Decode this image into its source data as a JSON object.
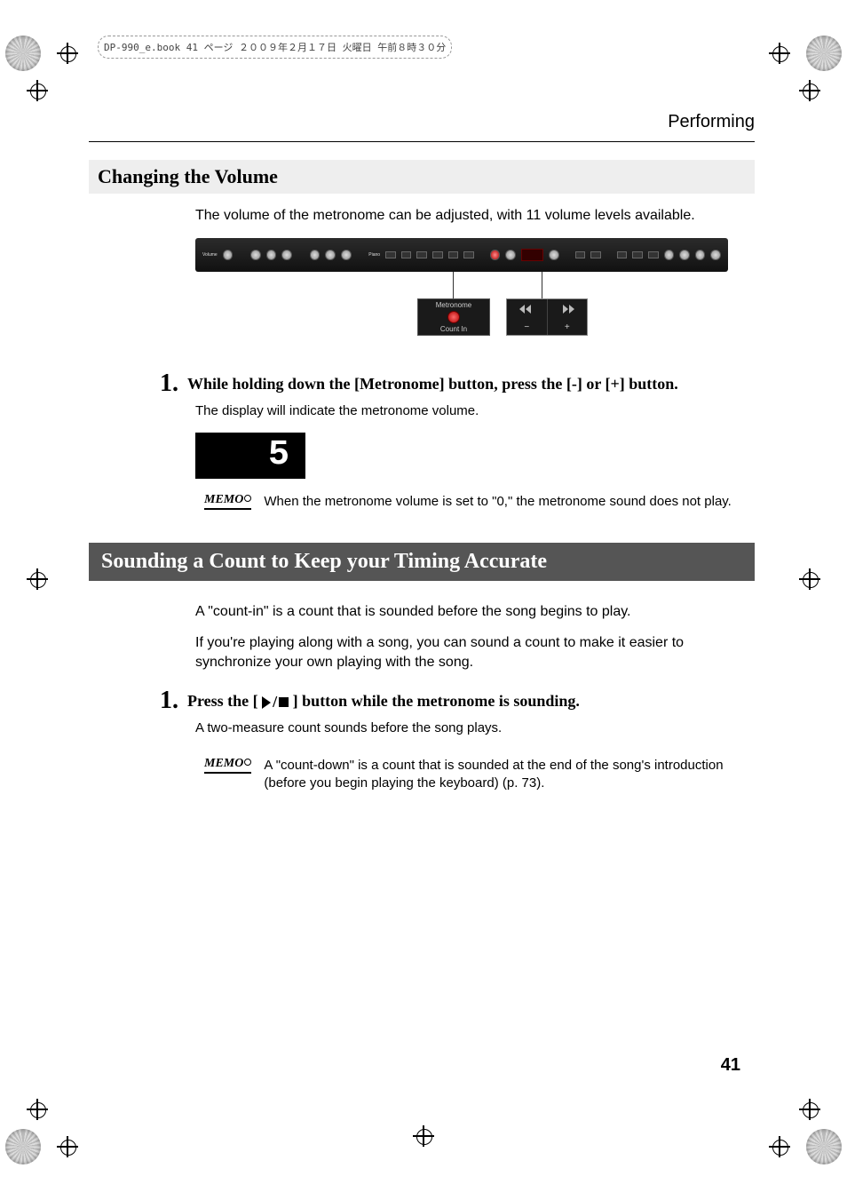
{
  "meta": {
    "header_slug": "DP-990_e.book 41 ページ ２００９年２月１７日 火曜日 午前８時３０分"
  },
  "section_label": "Performing",
  "sub1": {
    "title": "Changing the Volume",
    "intro": "The volume of the metronome can be adjusted, with 11 volume levels available."
  },
  "step1": {
    "num": "1.",
    "head": "While holding down the [Metronome] button, press the [-] or [+] button.",
    "body": "The display will indicate the metronome volume."
  },
  "display_value": "5",
  "memo1": "When the metronome volume is set to \"0,\" the metronome sound does not play.",
  "sub2": {
    "title": "Sounding a Count to Keep your Timing Accurate",
    "p1": "A \"count-in\" is a count that is sounded before the song begins to play.",
    "p2": "If you're playing along with a song, you can sound a count to make it easier to synchronize your own playing with the song."
  },
  "step2": {
    "num": "1.",
    "head_pre": "Press the [",
    "head_post": "] button while the metronome is sounding.",
    "body": "A two-measure count sounds before the song plays."
  },
  "memo2": "A \"count-down\" is a count that is sounded at the end of the song's introduction (before you begin playing the keyboard) (p. 73).",
  "callouts": {
    "metronome_label_top": "Metronome",
    "metronome_label_bottom": "Count In",
    "minus": "−",
    "plus": "+"
  },
  "page_number": "41"
}
